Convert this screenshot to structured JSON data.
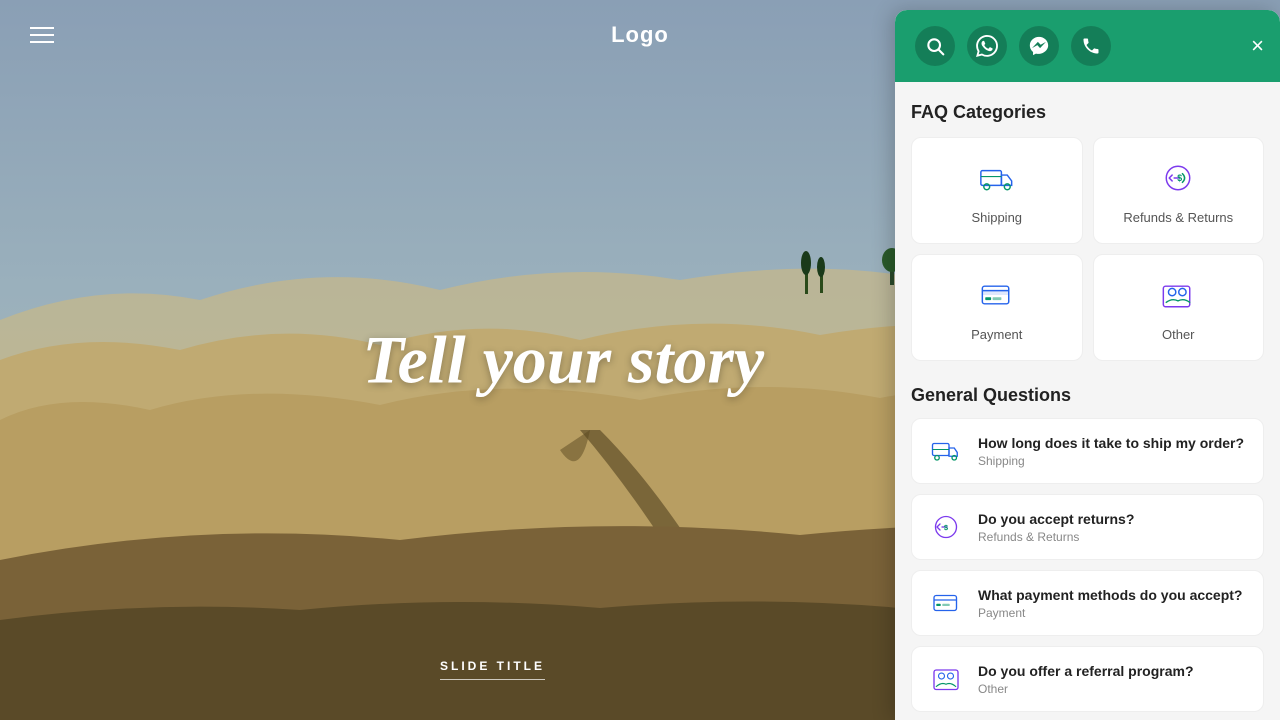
{
  "hero": {
    "headline": "Tell your story",
    "slide_title": "SLIDE TITLE"
  },
  "nav": {
    "logo": "Logo",
    "hamburger_label": "Menu"
  },
  "panel": {
    "close_label": "×",
    "header": {
      "icons": [
        {
          "name": "search",
          "symbol": "🔍"
        },
        {
          "name": "whatsapp",
          "symbol": "💬"
        },
        {
          "name": "messenger",
          "symbol": "💬"
        },
        {
          "name": "phone",
          "symbol": "📞"
        }
      ]
    },
    "faq_categories_title": "FAQ Categories",
    "categories": [
      {
        "id": "shipping",
        "label": "Shipping"
      },
      {
        "id": "refunds",
        "label": "Refunds & Returns"
      },
      {
        "id": "payment",
        "label": "Payment"
      },
      {
        "id": "other",
        "label": "Other"
      }
    ],
    "general_questions_title": "General Questions",
    "questions": [
      {
        "id": "q1",
        "question": "How long does it take to ship my order?",
        "category": "Shipping"
      },
      {
        "id": "q2",
        "question": "Do you accept returns?",
        "category": "Refunds & Returns"
      },
      {
        "id": "q3",
        "question": "What payment methods do you accept?",
        "category": "Payment"
      },
      {
        "id": "q4",
        "question": "Do you offer a referral program?",
        "category": "Other"
      }
    ]
  },
  "colors": {
    "green": "#1a9e6e",
    "white": "#ffffff"
  }
}
